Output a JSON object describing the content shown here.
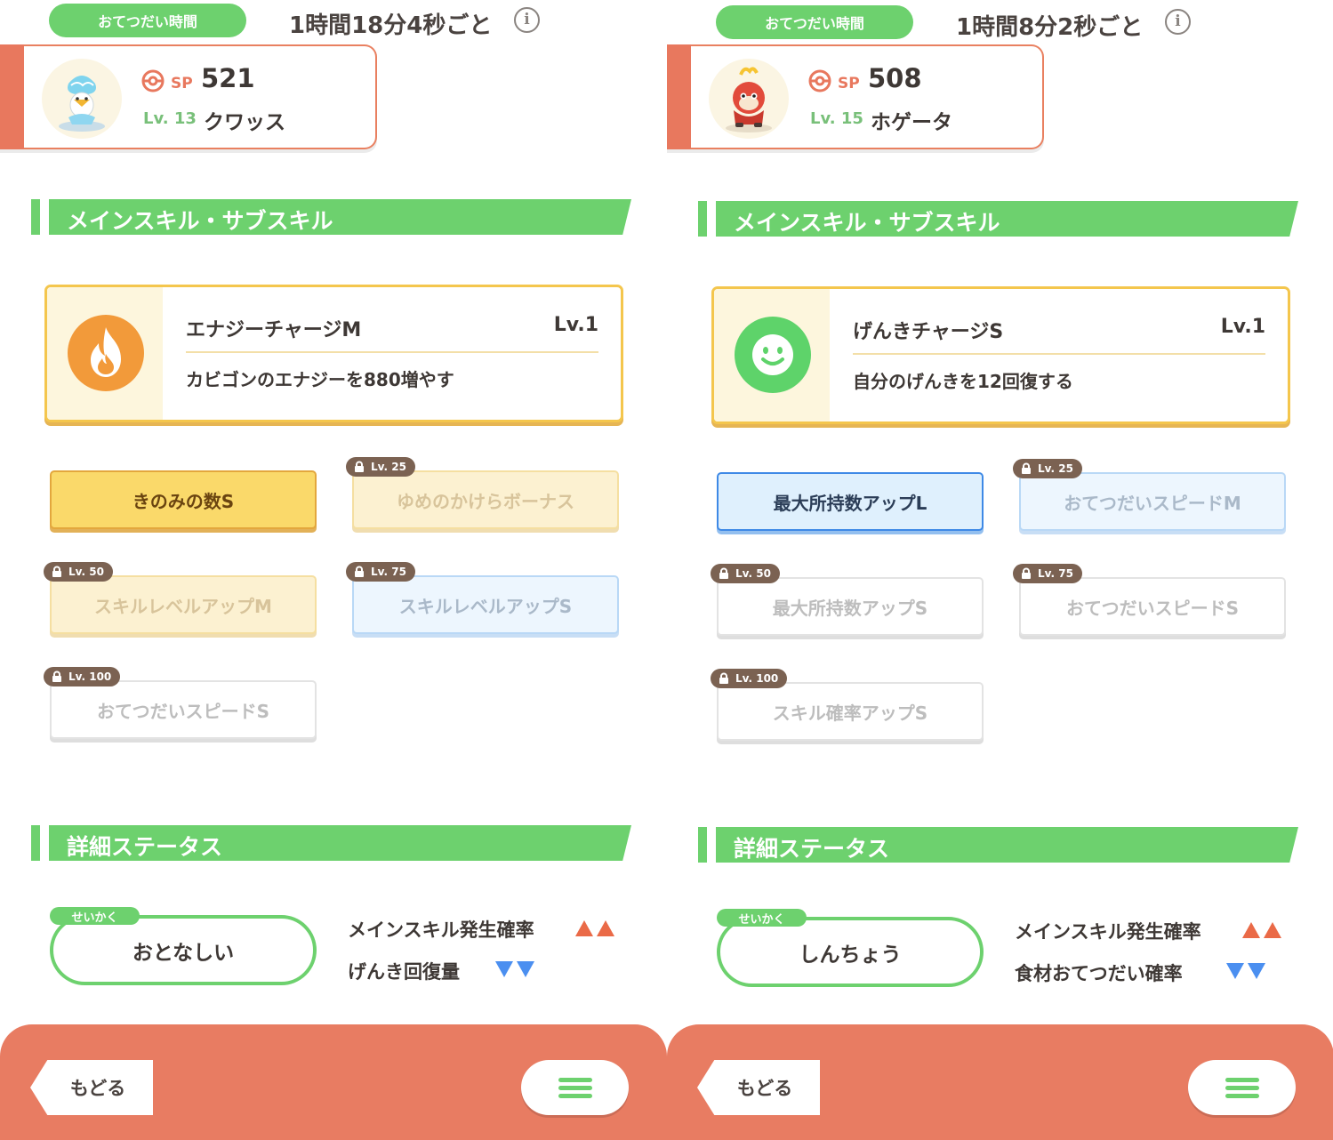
{
  "panels": [
    {
      "help": {
        "label": "おてつだい時間",
        "time": "1時間18分4秒ごと"
      },
      "pokemon": {
        "sp_label": "SP",
        "sp_value": "521",
        "level": "Lv. 13",
        "name": "クワッス"
      },
      "skills_section_title": "メインスキル・サブスキル",
      "main_skill": {
        "name": "エナジーチャージM",
        "level": "Lv.1",
        "description": "カビゴンのエナジーを880増やす",
        "icon": "flame-icon",
        "icon_color": "#f29a3a"
      },
      "sub_skills": [
        {
          "label": "きのみの数S",
          "locked_level": ""
        },
        {
          "label": "ゆめのかけらボーナス",
          "locked_level": "Lv. 25"
        },
        {
          "label": "スキルレベルアップM",
          "locked_level": "Lv. 50"
        },
        {
          "label": "スキルレベルアップS",
          "locked_level": "Lv. 75"
        },
        {
          "label": "おてつだいスピードS",
          "locked_level": "Lv. 100"
        }
      ],
      "status_section_title": "詳細ステータス",
      "nature": {
        "tag": "せいかく",
        "value": "おとなしい"
      },
      "effects": [
        {
          "label": "メインスキル発生確率",
          "direction": "up"
        },
        {
          "label": "げんき回復量",
          "direction": "down"
        }
      ],
      "footer": {
        "back_label": "もどる",
        "menu_icon": "menu-icon"
      }
    },
    {
      "help": {
        "label": "おてつだい時間",
        "time": "1時間8分2秒ごと"
      },
      "pokemon": {
        "sp_label": "SP",
        "sp_value": "508",
        "level": "Lv. 15",
        "name": "ホゲータ"
      },
      "skills_section_title": "メインスキル・サブスキル",
      "main_skill": {
        "name": "げんきチャージS",
        "level": "Lv.1",
        "description": "自分のげんきを12回復する",
        "icon": "smiley-icon",
        "icon_color": "#5ed36a"
      },
      "sub_skills": [
        {
          "label": "最大所持数アップL",
          "locked_level": ""
        },
        {
          "label": "おてつだいスピードM",
          "locked_level": "Lv. 25"
        },
        {
          "label": "最大所持数アップS",
          "locked_level": "Lv. 50"
        },
        {
          "label": "おてつだいスピードS",
          "locked_level": "Lv. 75"
        },
        {
          "label": "スキル確率アップS",
          "locked_level": "Lv. 100"
        }
      ],
      "status_section_title": "詳細ステータス",
      "nature": {
        "tag": "せいかく",
        "value": "しんちょう"
      },
      "effects": [
        {
          "label": "メインスキル発生確率",
          "direction": "up"
        },
        {
          "label": "食材おてつだい確率",
          "direction": "down"
        }
      ],
      "footer": {
        "back_label": "もどる",
        "menu_icon": "menu-icon"
      }
    }
  ],
  "colors": {
    "accent_green": "#6dd16e",
    "brand_coral": "#e8785e",
    "up_arrow": "#ea6a47",
    "down_arrow": "#4b8ff0"
  }
}
